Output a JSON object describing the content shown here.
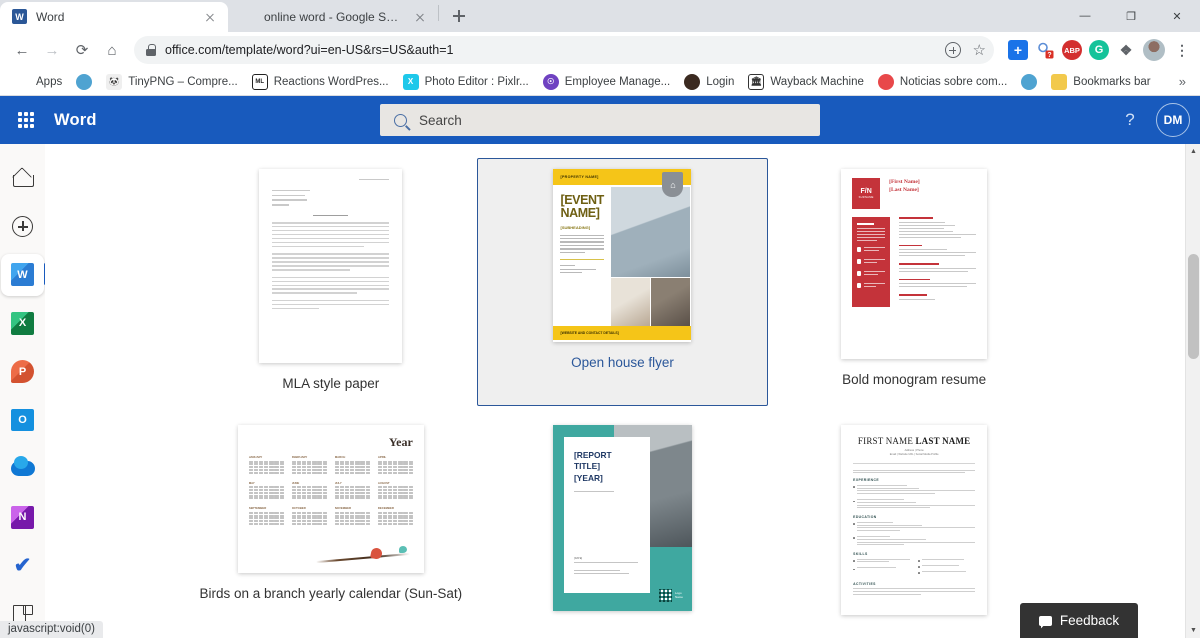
{
  "browser": {
    "tabs": [
      {
        "title": "Word",
        "favicon": "word-icon",
        "active": true
      },
      {
        "title": "online word - Google Search",
        "favicon": "google-icon",
        "active": false
      }
    ],
    "new_tab_label": "+",
    "window_controls": {
      "minimize": "—",
      "maximize": "❐",
      "close": "✕"
    },
    "nav": {
      "back": "←",
      "forward": "→",
      "reload": "⟳",
      "home": "⌂"
    },
    "url": "office.com/template/word?ui=en-US&rs=US&auth=1",
    "omnibox_right": {
      "install": "circle-plus-icon",
      "bookmark": "☆"
    },
    "extensions": [
      {
        "name": "add-extension",
        "glyph": "+"
      },
      {
        "name": "search-help-extension",
        "glyph": "?"
      },
      {
        "name": "adblock-plus-extension",
        "glyph": "ABP"
      },
      {
        "name": "grammarly-extension",
        "glyph": "G"
      },
      {
        "name": "puzzle-extensions-icon",
        "glyph": "❖"
      },
      {
        "name": "profile-avatar",
        "glyph": ""
      },
      {
        "name": "chrome-menu-icon",
        "glyph": "⋮"
      }
    ],
    "bookmarks": [
      {
        "label": "Apps",
        "icon": "apps-grid-icon",
        "color": "#ffffff"
      },
      {
        "label": "",
        "icon": "globe-icon",
        "color": "#4fa3d1"
      },
      {
        "label": "TinyPNG – Compre...",
        "icon": "panda-icon",
        "color": "#7a7a7a"
      },
      {
        "label": "Reactions WordPres...",
        "icon": "wordpress-icon",
        "color": "#222222"
      },
      {
        "label": "Photo Editor : Pixlr...",
        "icon": "pixlr-icon",
        "color": "#1ec8ea"
      },
      {
        "label": "Employee Manage...",
        "icon": "person-badge-icon",
        "color": "#6f42c1"
      },
      {
        "label": "Login",
        "icon": "login-icon",
        "color": "#3b2a20"
      },
      {
        "label": "Wayback Machine",
        "icon": "archive-icon",
        "color": "#444444"
      },
      {
        "label": "Noticias sobre com...",
        "icon": "news-icon",
        "color": "#e8484a"
      },
      {
        "label": "",
        "icon": "globe-icon",
        "color": "#4fa3d1"
      },
      {
        "label": "Bookmarks bar",
        "icon": "folder-icon",
        "color": "#f2c94c"
      }
    ],
    "bookmarks_overflow": "»",
    "status_text": "javascript:void(0)"
  },
  "office": {
    "waffle_label": "app-launcher",
    "app_name": "Word",
    "search": {
      "placeholder": "Search",
      "value": ""
    },
    "help_label": "?",
    "avatar_initials": "DM"
  },
  "sidebar": {
    "items": [
      {
        "name": "home",
        "label": "Home",
        "active": false
      },
      {
        "name": "create",
        "label": "Create",
        "active": false
      },
      {
        "name": "word",
        "label": "Word",
        "active": true
      },
      {
        "name": "excel",
        "label": "Excel",
        "active": false
      },
      {
        "name": "powerpoint",
        "label": "PowerPoint",
        "active": false
      },
      {
        "name": "outlook",
        "label": "Outlook",
        "active": false
      },
      {
        "name": "onedrive",
        "label": "OneDrive",
        "active": false
      },
      {
        "name": "onenote",
        "label": "OneNote",
        "active": false
      },
      {
        "name": "todo",
        "label": "To Do",
        "active": false
      },
      {
        "name": "all-apps",
        "label": "All apps",
        "active": false
      }
    ],
    "letters": {
      "word": "W",
      "excel": "X",
      "powerpoint": "P",
      "onenote": "N",
      "todo": "✔"
    }
  },
  "templates": [
    {
      "label": "MLA style paper",
      "selected": false
    },
    {
      "label": "Open house flyer",
      "selected": true
    },
    {
      "label": "Bold monogram resume",
      "selected": false
    },
    {
      "label": "Birds on a branch yearly calendar (Sun-Sat)",
      "selected": false
    },
    {
      "label": "",
      "selected": false
    },
    {
      "label": "",
      "selected": false
    }
  ],
  "thumbnails": {
    "flyer": {
      "property_name": "[PROPERTY NAME]",
      "event_name": "[EVENT NAME]",
      "subheading": "[SUBHEADING]",
      "footer": "[WEBSITE AND CONTACT DETAILS]",
      "house_icon": "⌂"
    },
    "monogram": {
      "initials": "F/N",
      "small": "SURNAME",
      "first_name": "[First Name]",
      "last_name": "[Last Name]"
    },
    "calendar": {
      "year": "Year"
    },
    "report": {
      "title_line1": "[REPORT TITLE]",
      "title_line2": "[YEAR]",
      "logo_text": "Logo\nName"
    },
    "resume": {
      "first_name": "FIRST NAME ",
      "last_name": "LAST NAME",
      "sections": [
        "EXPERIENCE",
        "EDUCATION",
        "SKILLS",
        "ACTIVITIES"
      ]
    }
  },
  "feedback": {
    "label": "Feedback",
    "icon": "speech-bubble-icon"
  },
  "scrollbar": {
    "up": "▲",
    "down": "▼"
  },
  "colors": {
    "office_blue": "#185abd",
    "selection_blue": "#2b579a",
    "flyer_yellow": "#f5c518",
    "resume_red": "#c4333a",
    "report_teal": "#3fa8a0"
  }
}
